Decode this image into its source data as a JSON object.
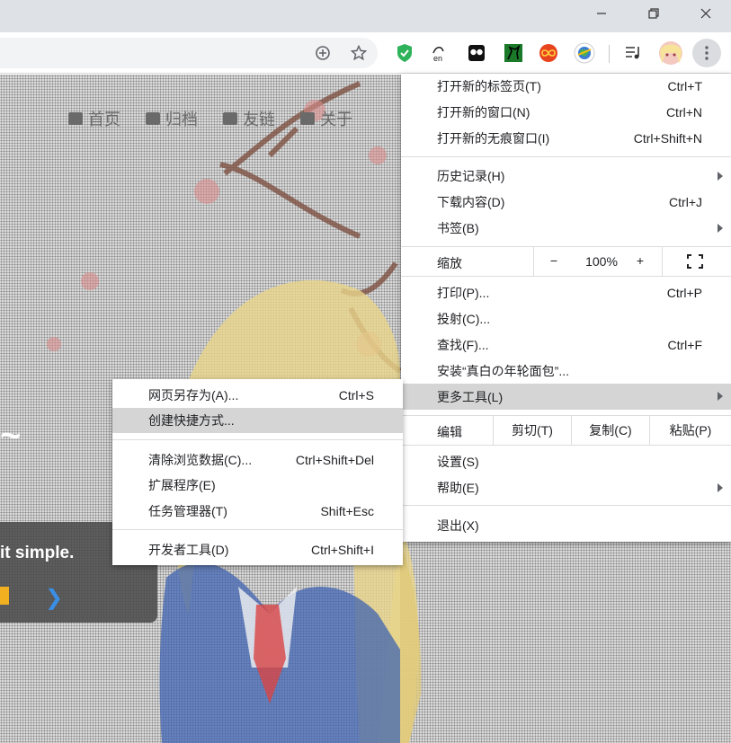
{
  "window": {
    "minimize_icon": "minimize-icon",
    "restore_icon": "restore-icon",
    "close_icon": "close-icon"
  },
  "toolbar": {
    "icons": [
      "add-circle-icon",
      "star-icon",
      "green-shield-extension-icon",
      "translate-extension-icon",
      "dice-extension-icon",
      "horse-extension-icon",
      "infinity-extension-icon",
      "globe-extension-icon",
      "media-queue-icon",
      "avatar",
      "kebab-menu-icon"
    ],
    "translate_badge": "en"
  },
  "page": {
    "nav": [
      "首页",
      "归档",
      "友链",
      "关于"
    ],
    "banner_text": "it simple.",
    "banner_next": "❯"
  },
  "menu": {
    "new_tab": "打开新的标签页(T)",
    "new_tab_sc": "Ctrl+T",
    "new_window": "打开新的窗口(N)",
    "new_window_sc": "Ctrl+N",
    "new_incognito": "打开新的无痕窗口(I)",
    "new_incognito_sc": "Ctrl+Shift+N",
    "history": "历史记录(H)",
    "downloads": "下载内容(D)",
    "downloads_sc": "Ctrl+J",
    "bookmarks": "书签(B)",
    "zoom": "缩放",
    "zoom_minus": "−",
    "zoom_value": "100%",
    "zoom_plus": "+",
    "print": "打印(P)...",
    "print_sc": "Ctrl+P",
    "cast": "投射(C)...",
    "find": "查找(F)...",
    "find_sc": "Ctrl+F",
    "install": "安装“真白の年轮面包”...",
    "more_tools": "更多工具(L)",
    "edit": "编辑",
    "cut": "剪切(T)",
    "copy": "复制(C)",
    "paste": "粘贴(P)",
    "settings": "设置(S)",
    "help": "帮助(E)",
    "exit": "退出(X)"
  },
  "submenu": {
    "save_page": "网页另存为(A)...",
    "save_page_sc": "Ctrl+S",
    "create_shortcut": "创建快捷方式...",
    "clear_data": "清除浏览数据(C)...",
    "clear_data_sc": "Ctrl+Shift+Del",
    "extensions": "扩展程序(E)",
    "task_manager": "任务管理器(T)",
    "task_manager_sc": "Shift+Esc",
    "dev_tools": "开发者工具(D)",
    "dev_tools_sc": "Ctrl+Shift+I"
  },
  "colors": {
    "titlebar": "#dee1e6",
    "highlight": "#d5d5d5",
    "shield_green": "#2fb35a"
  }
}
